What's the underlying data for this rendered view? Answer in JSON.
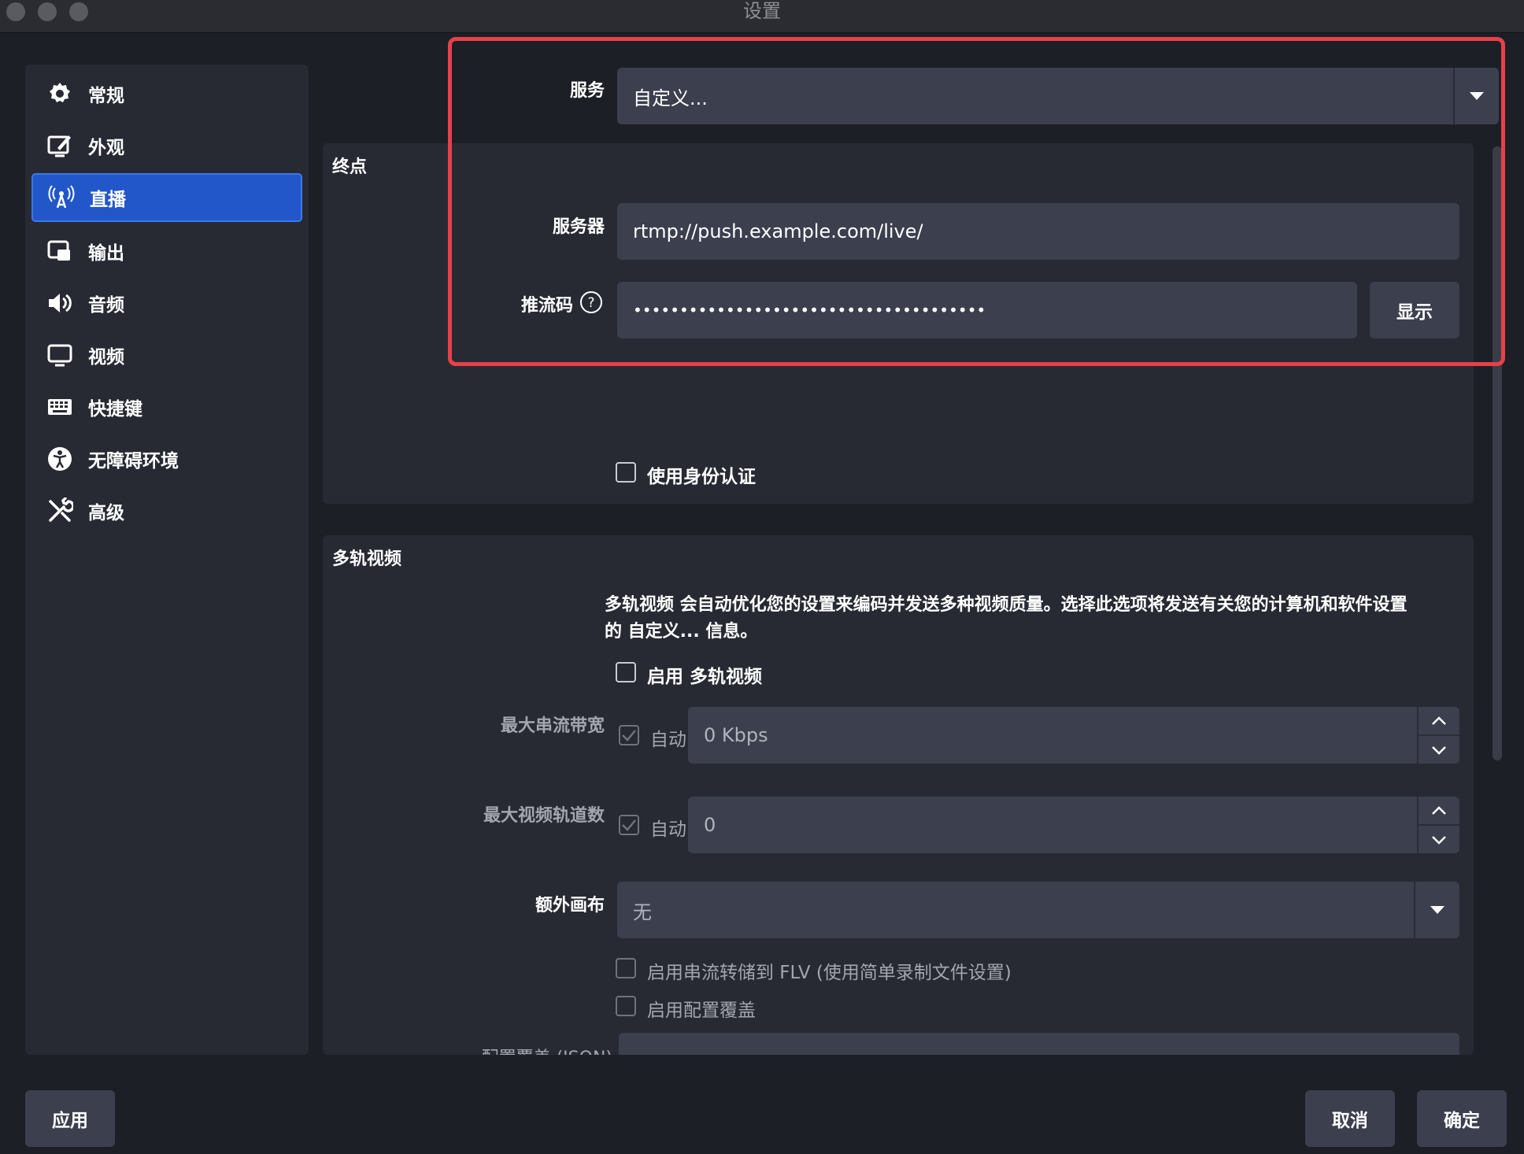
{
  "window": {
    "title": "设置"
  },
  "sidebar": {
    "items": [
      {
        "label": "常规",
        "icon": "gear-icon"
      },
      {
        "label": "外观",
        "icon": "appearance-icon"
      },
      {
        "label": "直播",
        "icon": "broadcast-icon",
        "active": true
      },
      {
        "label": "输出",
        "icon": "output-icon"
      },
      {
        "label": "音频",
        "icon": "speaker-icon"
      },
      {
        "label": "视频",
        "icon": "monitor-icon"
      },
      {
        "label": "快捷键",
        "icon": "keyboard-icon"
      },
      {
        "label": "无障碍环境",
        "icon": "accessibility-icon"
      },
      {
        "label": "高级",
        "icon": "tools-icon"
      }
    ]
  },
  "stream": {
    "service_label": "服务",
    "service_value": "自定义...",
    "endpoint_title": "终点",
    "server_label": "服务器",
    "server_value": "rtmp://push.example.com/live/",
    "key_label": "推流码",
    "key_value": "••••••••••••••••••••••••••••••••••••••••••••••••••••••••••••••••••••••••",
    "show_button": "显示",
    "use_auth_label": "使用身份认证"
  },
  "multitrack": {
    "title": "多轨视频",
    "description_line1": "多轨视频 会自动优化您的设置来编码并发送多种视频质量。选择此选项将发送有关您的计算机和软件设置",
    "description_line2": "的 自定义... 信息。",
    "enable_label": "启用 多轨视频",
    "max_bitrate_label": "最大串流带宽",
    "auto_label": "自动",
    "max_bitrate_value": "0 Kbps",
    "max_tracks_label": "最大视频轨道数",
    "max_tracks_value": "0",
    "extra_canvas_label": "额外画布",
    "extra_canvas_value": "无",
    "dump_flv_label": "启用串流转储到 FLV (使用简单录制文件设置)",
    "config_override_label": "启用配置覆盖",
    "config_json_label": "配置覆盖 (JSON)"
  },
  "footer": {
    "apply": "应用",
    "cancel": "取消",
    "ok": "确定"
  },
  "colors": {
    "accent": "#2157c9",
    "highlight_box": "#e8404a",
    "field_bg": "#3b3f4e",
    "panel_bg": "#272a33",
    "window_bg": "#1d1f26"
  }
}
